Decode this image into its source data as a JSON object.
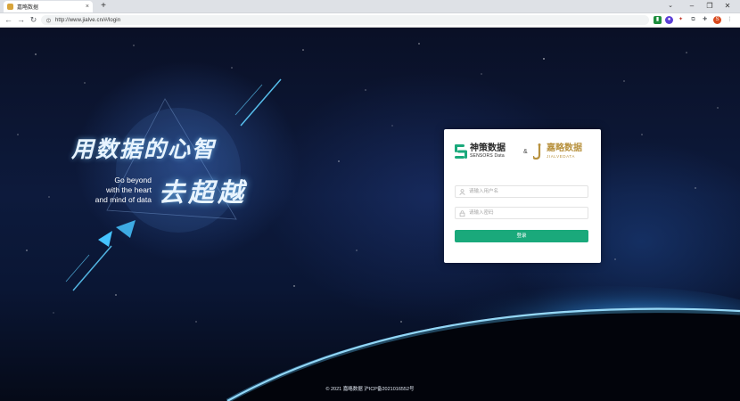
{
  "browser": {
    "tab_title": "嘉略数据",
    "tab_close": "×",
    "new_tab": "+",
    "tabs_dropdown": "⌄",
    "url": "http://www.jialve.cn/#/login",
    "window_controls": {
      "minimize": "–",
      "restore": "❐",
      "close": "✕"
    },
    "nav": {
      "back": "←",
      "forward": "→",
      "reload": "↻"
    },
    "profile_initial": "S"
  },
  "slogan": {
    "cn_line1": "用数据的心智",
    "cn_line2": "去超越",
    "en_line1": "Go beyond",
    "en_line2": "with the heart",
    "en_line3": "and mind of data"
  },
  "login": {
    "logo_sensors_cn": "神策数据",
    "logo_sensors_en": "SENSORS Data",
    "amp": "&",
    "logo_jialve_cn": "嘉略数据",
    "logo_jialve_en": "JIALVEDATA",
    "username_placeholder": "请输入用户名",
    "password_placeholder": "请输入密码",
    "login_button": "登录"
  },
  "footer": "© 2021 嘉略数据 沪ICP备2021016552号",
  "colors": {
    "accent": "#1aa97b",
    "jialve_gold": "#b8923f"
  }
}
